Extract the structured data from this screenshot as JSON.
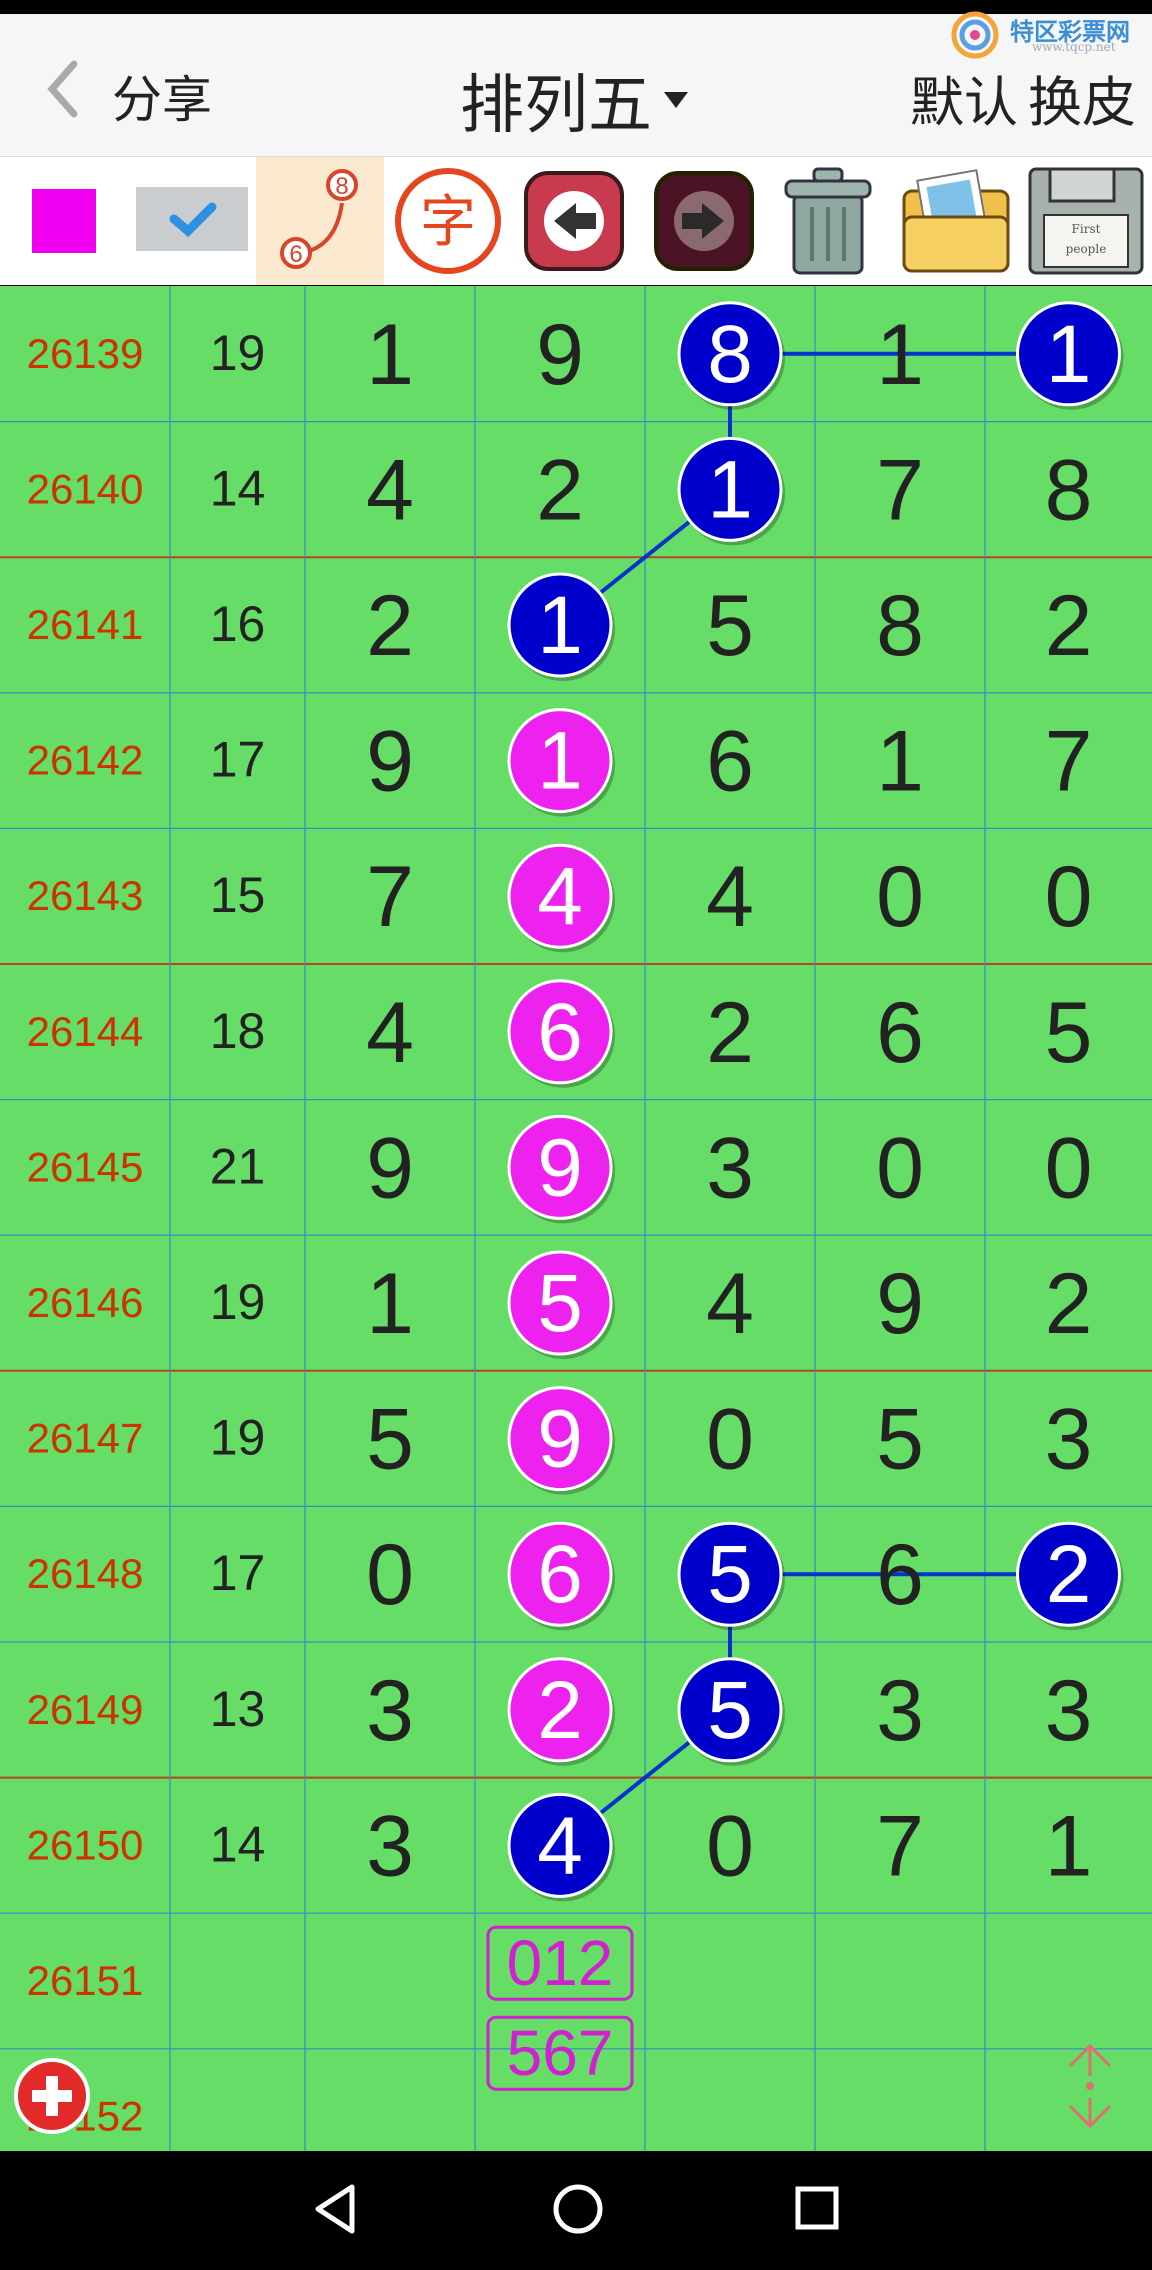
{
  "header": {
    "back_icon": "chevron-left-icon",
    "share_label": "分享",
    "title": "排列五",
    "default_label": "默认",
    "skin_label": "换皮",
    "logo_text": "特区彩票网",
    "logo_url": "www.tqcp.net"
  },
  "toolbar": {
    "tools": [
      {
        "name": "color-swatch",
        "icon": "color-swatch-icon",
        "color": "#f000f0"
      },
      {
        "name": "checkmark",
        "icon": "check-icon"
      },
      {
        "name": "connect-line",
        "icon": "link-dots-icon",
        "badge_top": "8",
        "badge_bottom": "6"
      },
      {
        "name": "text",
        "icon": "text-char-icon",
        "label": "字"
      },
      {
        "name": "undo",
        "icon": "arrow-left-icon"
      },
      {
        "name": "redo",
        "icon": "arrow-right-icon"
      },
      {
        "name": "delete",
        "icon": "trash-icon"
      },
      {
        "name": "pictures",
        "icon": "photo-folder-icon"
      },
      {
        "name": "save",
        "icon": "floppy-disk-icon",
        "label_1": "First",
        "label_2": "people"
      }
    ]
  },
  "table": {
    "colors": {
      "bg": "#66dd66",
      "period": "#cc3300",
      "text": "#222222",
      "blue_ball": "#0000cc",
      "magenta_ball": "#ee22ee",
      "line": "#0033cc"
    },
    "rows": [
      {
        "period": "26139",
        "sum": "19",
        "digits": [
          "1",
          "9",
          "8",
          "1",
          "1"
        ],
        "balls": {
          "2": "blue",
          "4": "blue"
        }
      },
      {
        "period": "26140",
        "sum": "14",
        "digits": [
          "4",
          "2",
          "1",
          "7",
          "8"
        ],
        "balls": {
          "2": "blue"
        }
      },
      {
        "period": "26141",
        "sum": "16",
        "digits": [
          "2",
          "1",
          "5",
          "8",
          "2"
        ],
        "balls": {
          "1": "blue"
        }
      },
      {
        "period": "26142",
        "sum": "17",
        "digits": [
          "9",
          "1",
          "6",
          "1",
          "7"
        ],
        "balls": {
          "1": "magenta"
        }
      },
      {
        "period": "26143",
        "sum": "15",
        "digits": [
          "7",
          "4",
          "4",
          "0",
          "0"
        ],
        "balls": {
          "1": "magenta"
        }
      },
      {
        "period": "26144",
        "sum": "18",
        "digits": [
          "4",
          "6",
          "2",
          "6",
          "5"
        ],
        "balls": {
          "1": "magenta"
        }
      },
      {
        "period": "26145",
        "sum": "21",
        "digits": [
          "9",
          "9",
          "3",
          "0",
          "0"
        ],
        "balls": {
          "1": "magenta"
        }
      },
      {
        "period": "26146",
        "sum": "19",
        "digits": [
          "1",
          "5",
          "4",
          "9",
          "2"
        ],
        "balls": {
          "1": "magenta"
        }
      },
      {
        "period": "26147",
        "sum": "19",
        "digits": [
          "5",
          "9",
          "0",
          "5",
          "3"
        ],
        "balls": {
          "1": "magenta"
        }
      },
      {
        "period": "26148",
        "sum": "17",
        "digits": [
          "0",
          "6",
          "5",
          "6",
          "2"
        ],
        "balls": {
          "1": "magenta",
          "2": "blue",
          "4": "blue"
        }
      },
      {
        "period": "26149",
        "sum": "13",
        "digits": [
          "3",
          "2",
          "5",
          "3",
          "3"
        ],
        "balls": {
          "1": "magenta",
          "2": "blue"
        }
      },
      {
        "period": "26150",
        "sum": "14",
        "digits": [
          "3",
          "4",
          "0",
          "7",
          "1"
        ],
        "balls": {
          "1": "blue"
        }
      },
      {
        "period": "26151",
        "sum": "",
        "digits": [
          "",
          "",
          "",
          "",
          ""
        ],
        "balls": {}
      },
      {
        "period": "26152",
        "sum": "",
        "digits": [
          "",
          "",
          "",
          "",
          ""
        ],
        "balls": {}
      }
    ],
    "prediction_boxes": [
      "012",
      "567"
    ]
  },
  "floating": {
    "add_icon": "plus-circle-icon",
    "scroll_icon": "scroll-updown-icon"
  },
  "navbar": {
    "back_icon": "nav-back-triangle-icon",
    "home_icon": "nav-home-circle-icon",
    "recent_icon": "nav-recent-square-icon"
  }
}
